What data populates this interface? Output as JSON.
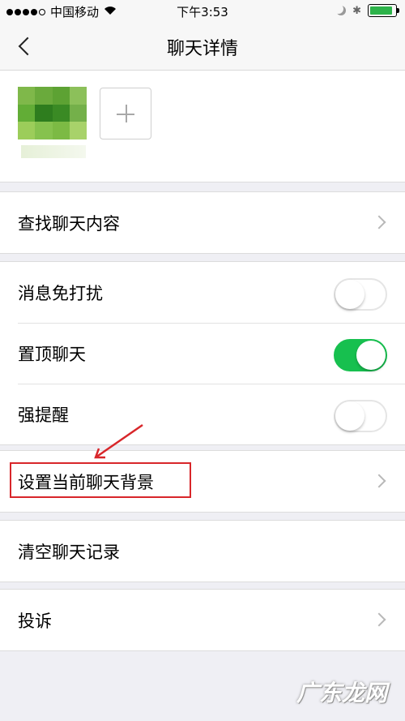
{
  "status": {
    "carrier": "中国移动",
    "time": "下午3:53",
    "battery_level": 0.9,
    "battery_color": "#2db34a"
  },
  "nav": {
    "title": "聊天详情"
  },
  "members": {
    "avatar_colors": [
      "#7fb84a",
      "#6aaa3c",
      "#5da233",
      "#8cc05a",
      "#62ad36",
      "#2e7d1e",
      "#3a8a24",
      "#74b04a",
      "#9ccd5a",
      "#86c24e",
      "#7cba44",
      "#a8d26a"
    ]
  },
  "rows": {
    "search": "查找聊天内容",
    "mute": "消息免打扰",
    "pin": "置顶聊天",
    "strong_remind": "强提醒",
    "background": "设置当前聊天背景",
    "clear": "清空聊天记录",
    "report": "投诉"
  },
  "toggles": {
    "mute": false,
    "pin": true,
    "strong_remind": false,
    "on_color": "#17c04f"
  },
  "annotation": {
    "highlight_color": "#d8262a"
  },
  "watermark": "广东龙网"
}
